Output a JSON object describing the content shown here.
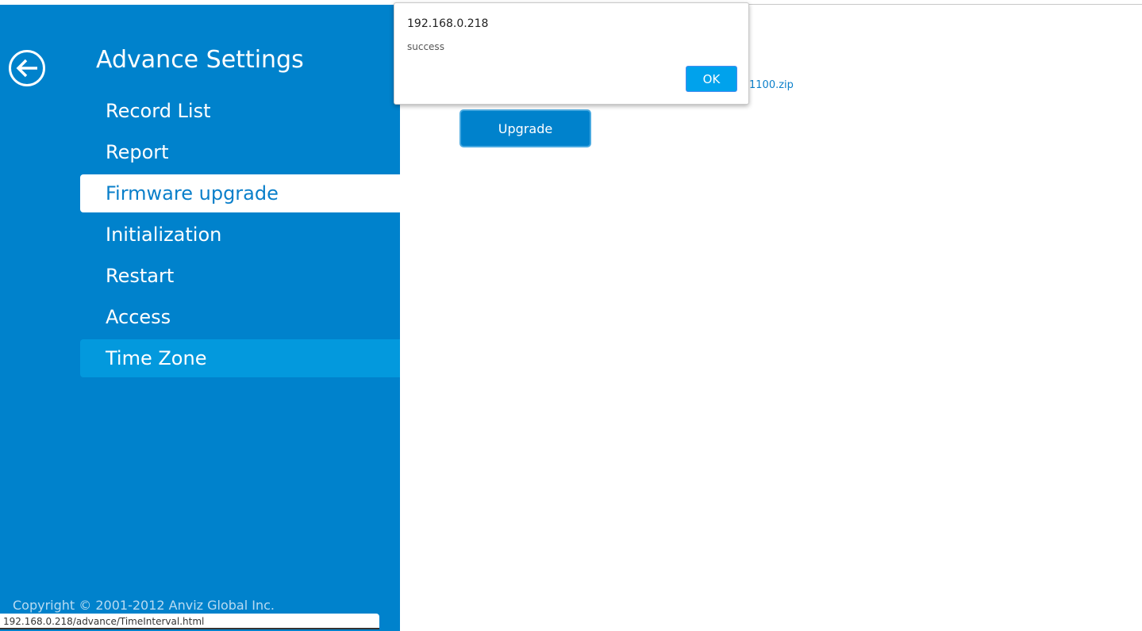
{
  "sidebar": {
    "title": "Advance Settings",
    "back_icon": "arrow-left-circle-icon",
    "items": [
      {
        "label": "Record List"
      },
      {
        "label": "Report"
      },
      {
        "label": "Firmware upgrade",
        "active": true
      },
      {
        "label": "Initialization"
      },
      {
        "label": "Restart"
      },
      {
        "label": "Access"
      },
      {
        "label": "Time Zone",
        "hover": true
      }
    ],
    "copyright": "Copyright © 2001-2012 Anviz Global Inc."
  },
  "main": {
    "file_name": "1100.zip",
    "upgrade_label": "Upgrade"
  },
  "dialog": {
    "title": "192.168.0.218",
    "message": "success",
    "ok_label": "OK"
  },
  "status_bar": {
    "url": "192.168.0.218/advance/TimeInterval.html"
  },
  "colors": {
    "sidebar": "#0082cc",
    "accent": "#00a2ec",
    "hover": "#0399dd"
  }
}
